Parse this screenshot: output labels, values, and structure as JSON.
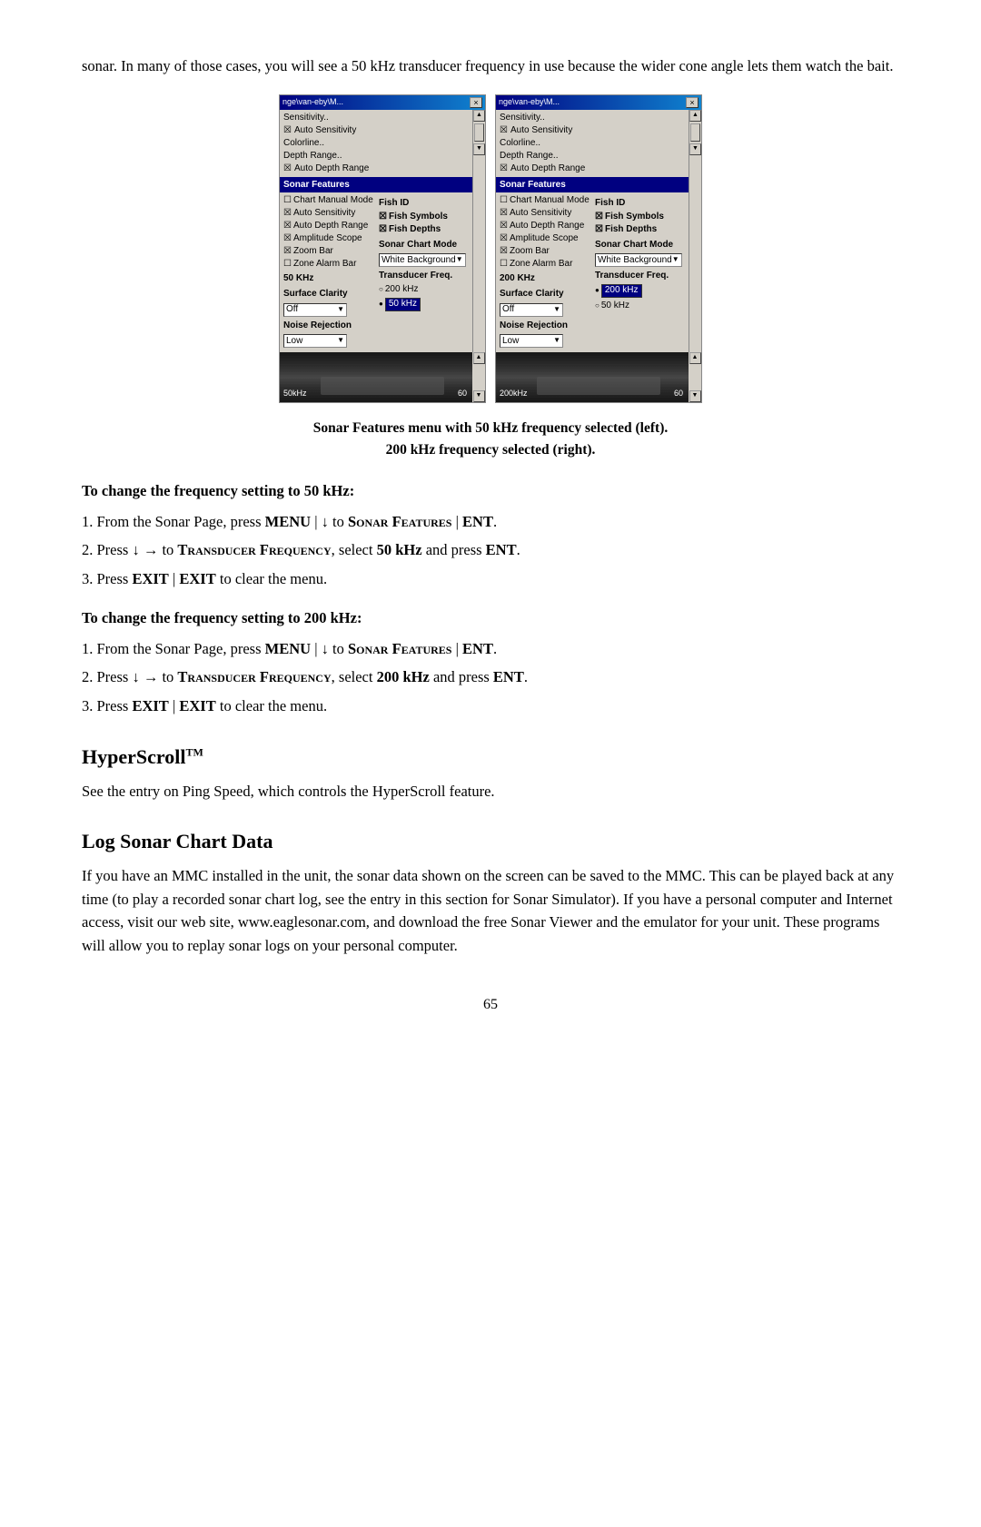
{
  "intro": {
    "text": "sonar. In many of those cases, you will see a 50 kHz transducer frequency in use because the wider cone angle lets them watch the bait."
  },
  "screenshots": {
    "left": {
      "title": "nge\\van-eby\\M...",
      "top_items": [
        "Sensitivity..",
        "× Auto Sensitivity",
        "Colorline..",
        "Depth Range..",
        "× Auto Depth Range"
      ],
      "sonar_features_label": "Sonar Features",
      "col1_items": [
        {
          "type": "checkbox_empty",
          "label": "Chart Manual Mode"
        },
        {
          "type": "checkbox_x",
          "label": "Auto Sensitivity"
        },
        {
          "type": "checkbox_x",
          "label": "Auto Depth Range"
        },
        {
          "type": "checkbox_x",
          "label": "Amplitude Scope"
        },
        {
          "type": "checkbox_x",
          "label": "Zoom Bar"
        },
        {
          "type": "checkbox_empty",
          "label": "Zone Alarm Bar"
        },
        {
          "type": "label",
          "label": "50 KHz"
        },
        {
          "type": "label_bold",
          "label": "Surface Clarity"
        },
        {
          "type": "dropdown",
          "value": "Off"
        },
        {
          "type": "label_bold",
          "label": "Noise Rejection"
        },
        {
          "type": "dropdown",
          "value": "Low"
        }
      ],
      "col2_items": [
        {
          "type": "label_bold",
          "label": "Fish ID"
        },
        {
          "type": "checkbox_x_bold",
          "label": "Fish Symbols"
        },
        {
          "type": "checkbox_x_bold",
          "label": "Fish Depths"
        },
        {
          "type": "label_bold",
          "label": "Sonar Chart Mode"
        },
        {
          "type": "dropdown",
          "value": "White Background"
        },
        {
          "type": "label_bold",
          "label": "Transducer Freq."
        },
        {
          "type": "radio_empty",
          "label": "200 kHz"
        },
        {
          "type": "radio_sel_highlighted",
          "label": "50 kHz"
        }
      ],
      "sonar_freq": "50kHz",
      "sonar_num": "60"
    },
    "right": {
      "title": "nge\\van-eby\\M...",
      "top_items": [
        "Sensitivity..",
        "× Auto Sensitivity",
        "Colorline..",
        "Depth Range..",
        "× Auto Depth Range"
      ],
      "sonar_features_label": "Sonar Features",
      "col1_items": [
        {
          "type": "checkbox_empty",
          "label": "Chart Manual Mode"
        },
        {
          "type": "checkbox_x",
          "label": "Auto Sensitivity"
        },
        {
          "type": "checkbox_x",
          "label": "Auto Depth Range"
        },
        {
          "type": "checkbox_x",
          "label": "Amplitude Scope"
        },
        {
          "type": "checkbox_x",
          "label": "Zoom Bar"
        },
        {
          "type": "checkbox_empty",
          "label": "Zone Alarm Bar"
        },
        {
          "type": "label",
          "label": "200 KHz"
        },
        {
          "type": "label_bold",
          "label": "Surface Clarity"
        },
        {
          "type": "dropdown",
          "value": "Off"
        },
        {
          "type": "label_bold",
          "label": "Noise Rejection"
        },
        {
          "type": "dropdown",
          "value": "Low"
        }
      ],
      "col2_items": [
        {
          "type": "label_bold",
          "label": "Fish ID"
        },
        {
          "type": "checkbox_x_bold",
          "label": "Fish Symbols"
        },
        {
          "type": "checkbox_x_bold",
          "label": "Fish Depths"
        },
        {
          "type": "label_bold",
          "label": "Sonar Chart Mode"
        },
        {
          "type": "dropdown",
          "value": "White Background"
        },
        {
          "type": "label_bold",
          "label": "Transducer Freq."
        },
        {
          "type": "radio_sel_highlighted",
          "label": "200 kHz"
        },
        {
          "type": "radio_empty",
          "label": "50 kHz"
        }
      ],
      "sonar_freq": "200kHz",
      "sonar_num": "60"
    }
  },
  "caption": {
    "line1": "Sonar Features menu with 50 kHz frequency selected (left).",
    "line2": "200 kHz frequency selected (right)."
  },
  "section1": {
    "heading": "To change the frequency setting to 50 kHz:",
    "steps": [
      {
        "num": "1.",
        "text_before": "From the Sonar Page, press ",
        "kbd1": "MENU",
        "sep1": " | ↓ to ",
        "sc1": "Sonar Features",
        "sep2": " | ",
        "kbd2": "ENT",
        "text_after": "."
      },
      {
        "num": "2.",
        "text_before": "Press ↓ → to ",
        "sc1": "Transducer Frequency",
        "sep1": ", select ",
        "kbd1": "50 kHz",
        "sep2": " and press ",
        "kbd2": "ENT",
        "text_after": "."
      },
      {
        "num": "3.",
        "text_before": "Press ",
        "kbd1": "EXIT",
        "sep1": " | ",
        "kbd2": "EXIT",
        "text_after": " to clear the menu."
      }
    ]
  },
  "section2": {
    "heading": "To change the frequency setting to 200 kHz:",
    "steps": [
      {
        "num": "1.",
        "text_before": "From the Sonar Page, press ",
        "kbd1": "MENU",
        "sep1": " | ↓ to ",
        "sc1": "Sonar Features",
        "sep2": " | ",
        "kbd2": "ENT",
        "text_after": "."
      },
      {
        "num": "2.",
        "text_before": "Press ↓ → to ",
        "sc1": "Transducer Frequency",
        "sep1": ", select ",
        "kbd1": "200 kHz",
        "sep2": " and  press ",
        "kbd2": "ENT",
        "text_after": "."
      },
      {
        "num": "3.",
        "text_before": "Press ",
        "kbd1": "EXIT",
        "sep1": " | ",
        "kbd2": "EXIT",
        "text_after": " to clear the menu."
      }
    ]
  },
  "hyperscroll": {
    "heading": "HyperScroll",
    "tm": "TM",
    "body": "See the entry on Ping Speed, which controls the HyperScroll feature."
  },
  "log_sonar": {
    "heading": "Log Sonar Chart Data",
    "body": "If you have an MMC installed in the unit, the sonar data shown on the screen can be saved to the MMC. This can be played back at any time (to play a recorded sonar chart log, see the entry in this section for Sonar Simulator). If you have a personal computer and Internet access, visit our web site, www.eaglesonar.com, and download the free Sonar Viewer and the emulator for your unit. These programs will allow you to replay sonar logs on your personal computer."
  },
  "page_number": "65"
}
